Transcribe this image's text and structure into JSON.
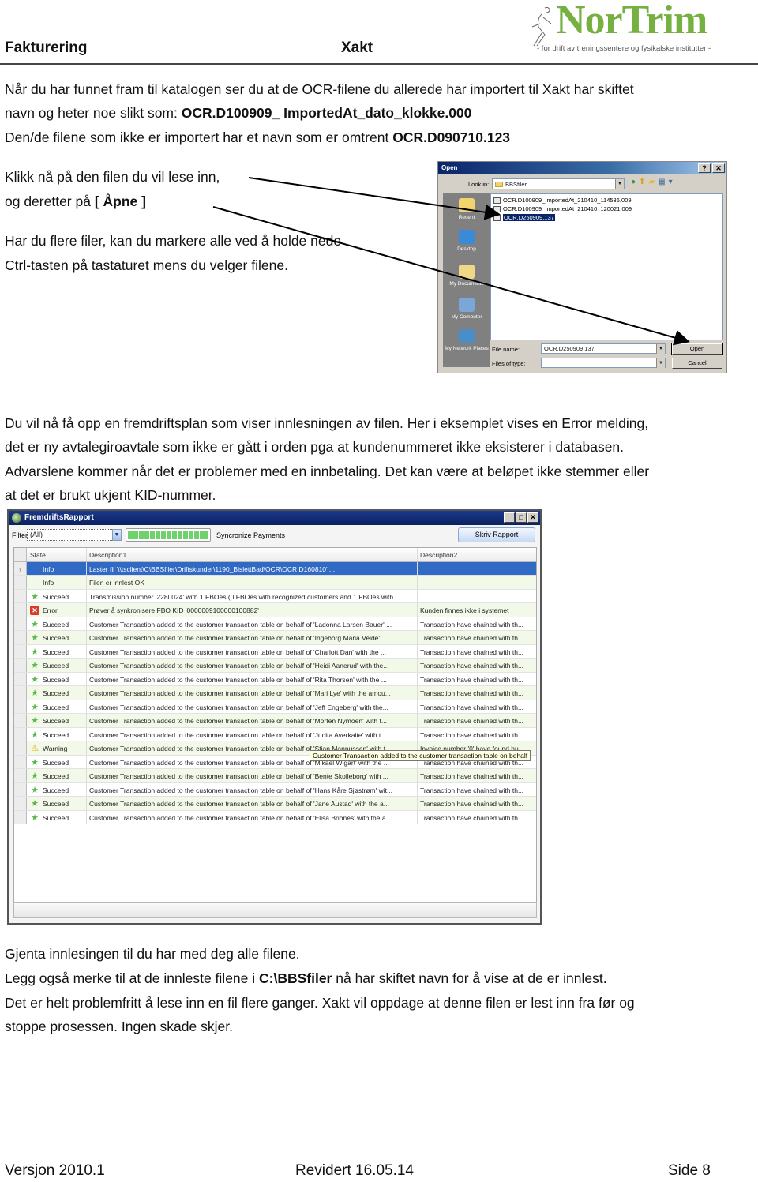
{
  "header": {
    "left": "Fakturering",
    "center": "Xakt",
    "logo": {
      "name": "NorTrim",
      "tagline": "- for drift av treningssentere og fysikalske institutter -",
      "color": "#76b041"
    }
  },
  "intro": {
    "line1": "Når du har funnet fram til katalogen ser du at de OCR-filene du allerede har importert til Xakt har skiftet",
    "line2_prefix": "navn og heter noe slikt som:  ",
    "line2_bold": "OCR.D100909_ ImportedAt_dato_klokke.000",
    "line3_prefix": "Den/de  filene som ikke er importert har et navn som er omtrent ",
    "line3_bold": "OCR.D090710.123"
  },
  "instructions": {
    "line1": "Klikk nå på den filen du vil lese inn,",
    "line2_prefix": "og deretter på ",
    "line2_bold": "[ Åpne ]",
    "line3": "Har du flere filer, kan du markere alle ved å holde nede",
    "line4": "Ctrl-tasten på tastaturet mens du velger filene."
  },
  "open_dialog": {
    "title": "Open",
    "help_label": "?",
    "close_label": "✕",
    "look_in_label": "Look in:",
    "look_in_value": "BBSfiler",
    "nav_icons": "◀ ⬆ 📁 ▦▾",
    "places": [
      "Recent",
      "Desktop",
      "My Documents",
      "My Computer",
      "My Network Places"
    ],
    "files": [
      "OCR.D100909_ImportedAt_210410_114536.009",
      "OCR.D100909_ImportedAt_210410_120021.009",
      "OCR.D250909.137"
    ],
    "selected_file_index": 2,
    "file_name_label": "File name:",
    "file_name_value": "OCR.D250909.137",
    "file_type_label": "Files of type:",
    "file_type_value": "",
    "open_button": "Open",
    "cancel_button": "Cancel"
  },
  "description": {
    "line1": "Du vil nå få opp en fremdriftsplan som viser innlesningen av filen. Her i eksemplet vises en  Error melding,",
    "line2": "det er ny avtalegiroavtale som ikke er gått i orden pga at kundenummeret ikke eksisterer i databasen.",
    "line3": "Advarslene kommer når det er problemer med en innbetaling. Det kan være at beløpet ikke stemmer eller",
    "line4": "at det er brukt ukjent KID-nummer."
  },
  "progress_window": {
    "title": "FremdriftsRapport",
    "filter_label": "Filter",
    "filter_value": "(All)",
    "progress_percent": 100,
    "progress_label": "Syncronize Payments",
    "report_button": "Skriv Rapport",
    "columns": [
      "State",
      "Description1",
      "Description2"
    ],
    "rows": [
      {
        "marker": "›",
        "icon": "none",
        "state": "Info",
        "d1": "Laster fil '\\\\tsclient\\C\\BBSfiler\\Driftskunder\\1190_BislettBad\\OCR\\OCR.D160810' ...",
        "d2": ""
      },
      {
        "marker": "",
        "icon": "none",
        "state": "Info",
        "d1": "Filen er innlest OK",
        "d2": ""
      },
      {
        "marker": "",
        "icon": "star",
        "state": "Succeed",
        "d1": "Transmission number '2280024' with 1 FBOes (0 FBOes with recognized customers and 1 FBOes with...",
        "d2": ""
      },
      {
        "marker": "",
        "icon": "error",
        "state": "Error",
        "d1": "Prøver å synkronisere FBO KID '0000009100000100882'",
        "d2": "Kunden finnes ikke i systemet"
      },
      {
        "marker": "",
        "icon": "star",
        "state": "Succeed",
        "d1": "Customer Transaction added to the customer transaction table on behalf of 'Ladonna Larsen Bauer' ...",
        "d2": "Transaction have chained with th..."
      },
      {
        "marker": "",
        "icon": "star",
        "state": "Succeed",
        "d1": "Customer Transaction added to the customer transaction table on behalf of 'Ingeborg Maria Velde' ...",
        "d2": "Transaction have chained with th..."
      },
      {
        "marker": "",
        "icon": "star",
        "state": "Succeed",
        "d1": "Customer Transaction added to the customer transaction table on behalf of 'Charlott Dan' with the ...",
        "d2": "Transaction have chained with th..."
      },
      {
        "marker": "",
        "icon": "star",
        "state": "Succeed",
        "d1": "Customer Transaction added to the customer transaction table on behalf of 'Heidi Aanerud' with the...",
        "d2": "Transaction have chained with th..."
      },
      {
        "marker": "",
        "icon": "star",
        "state": "Succeed",
        "d1": "Customer Transaction added to the customer transaction table on behalf of 'Rita Thorsen' with the ...",
        "d2": "Transaction have chained with th..."
      },
      {
        "marker": "",
        "icon": "star",
        "state": "Succeed",
        "d1": "Customer Transaction added to the customer transaction table on behalf of 'Mari Lye' with the amou...",
        "d2": "Transaction have chained with th..."
      },
      {
        "marker": "",
        "icon": "star",
        "state": "Succeed",
        "d1": "Customer Transaction added to the customer transaction table on behalf of 'Jeff Engeberg' with the...",
        "d2": "Transaction have chained with th..."
      },
      {
        "marker": "",
        "icon": "star",
        "state": "Succeed",
        "d1": "Customer Transaction added to the customer transaction table on behalf of 'Morten Nymoen' with t...",
        "d2": "Transaction have chained with th..."
      },
      {
        "marker": "",
        "icon": "star",
        "state": "Succeed",
        "d1": "Customer Transaction added to the customer transaction table on behalf of 'Judita Averkaite' with t...",
        "d2": "Transaction have chained with th..."
      },
      {
        "marker": "",
        "icon": "warning",
        "state": "Warning",
        "d1": "Customer Transaction added to the customer transaction table on behalf of 'Stian Mannussen' with t...",
        "d2": "Invoice number '0' have found hu..."
      },
      {
        "marker": "",
        "icon": "star",
        "state": "Succeed",
        "d1": "Customer Transaction added to the customer transaction table on behalf of 'Mikael Wigart' with the ...",
        "d2": "Transaction have chained with th..."
      },
      {
        "marker": "",
        "icon": "star",
        "state": "Succeed",
        "d1": "Customer Transaction added to the customer transaction table on behalf of 'Bente  Skolleborg' with ...",
        "d2": "Transaction have chained with th..."
      },
      {
        "marker": "",
        "icon": "star",
        "state": "Succeed",
        "d1": "Customer Transaction added to the customer transaction table on behalf of 'Hans Kåre Sjøstrøm' wit...",
        "d2": "Transaction have chained with th..."
      },
      {
        "marker": "",
        "icon": "star",
        "state": "Succeed",
        "d1": "Customer Transaction added to the customer transaction table on behalf of 'Jane Austad' with the a...",
        "d2": "Transaction have chained with th..."
      },
      {
        "marker": "",
        "icon": "star",
        "state": "Succeed",
        "d1": "Customer Transaction added to the customer transaction table on behalf of 'Elisa Briones' with the a...",
        "d2": "Transaction have chained with th..."
      }
    ],
    "tooltip": "Customer Transaction added to the customer transaction table on behalf"
  },
  "closing": {
    "line1": "Gjenta innlesingen til du har med deg alle filene.",
    "line2_prefix": "Legg også merke til at de innleste filene i ",
    "line2_bold": "C:\\BBSfiler",
    "line2_suffix": " nå har skiftet navn for å vise at de er innlest.",
    "line3": "Det er helt problemfritt å lese inn en fil flere ganger. Xakt vil oppdage at denne filen er lest inn fra før og",
    "line4": "stoppe prosessen. Ingen skade skjer."
  },
  "footer": {
    "version": "Versjon 2010.1",
    "revised": "Revidert 16.05.14",
    "page": "Side 8"
  }
}
